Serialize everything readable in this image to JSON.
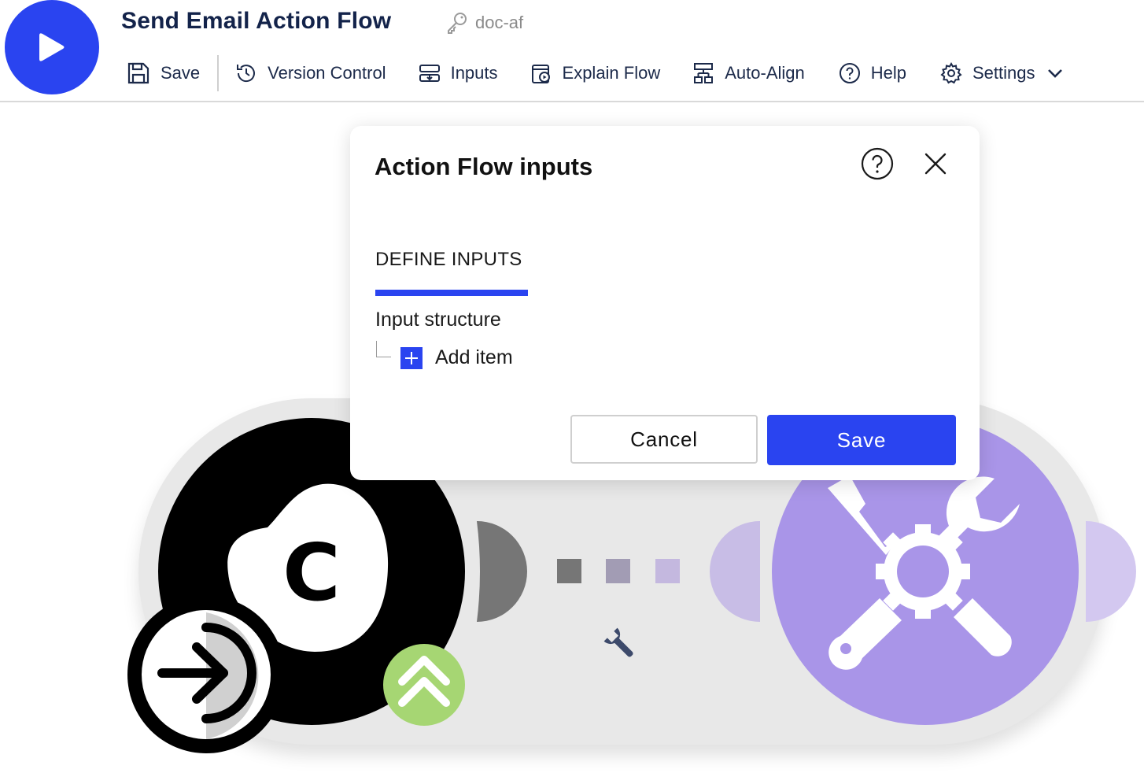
{
  "header": {
    "title": "Send Email Action Flow",
    "key_label": "doc-af"
  },
  "toolbar": {
    "save": "Save",
    "version_control": "Version Control",
    "inputs": "Inputs",
    "explain_flow": "Explain Flow",
    "auto_align": "Auto-Align",
    "help": "Help",
    "settings": "Settings"
  },
  "modal": {
    "title": "Action Flow inputs",
    "tab_label": "DEFINE INPUTS",
    "section_label": "Input structure",
    "add_item_label": "Add item",
    "cancel_label": "Cancel",
    "save_label": "Save"
  },
  "canvas": {
    "module_letter": "C",
    "colors": {
      "accent": "#2a44f0",
      "tools_module": "#a995e8",
      "trigger_badge": "#a6d673",
      "source_module": "#000000"
    },
    "icons": [
      "arrow-enter-icon",
      "double-chevron-up-icon",
      "wrench-icon",
      "tools-icon"
    ]
  }
}
